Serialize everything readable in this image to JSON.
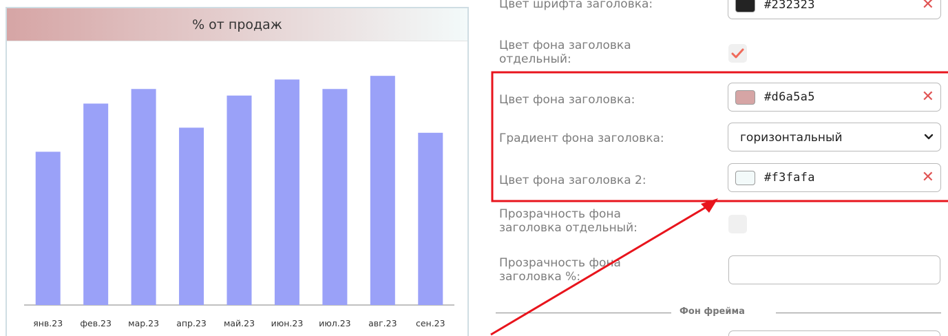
{
  "widget": {
    "title": "% от продаж",
    "header_gradient_from": "#d6a5a5",
    "header_gradient_to": "#f3fafa",
    "bar_color": "#9aa1f8"
  },
  "chart_data": {
    "type": "bar",
    "title": "% от продаж",
    "categories": [
      "янв.23",
      "фев.23",
      "мар.23",
      "апр.23",
      "май.23",
      "июн.23",
      "июл.23",
      "авг.23",
      "сен.23"
    ],
    "values": [
      210,
      276,
      296,
      243,
      287,
      309,
      296,
      314,
      236
    ],
    "xlabel": "",
    "ylabel": "",
    "ylim": [
      0,
      350
    ],
    "grid": false,
    "legend": "none"
  },
  "settings": {
    "header_font_color": {
      "label": "Цвет шрифта заголовка:",
      "value": "#232323",
      "swatch": "#232323"
    },
    "header_bg_separate": {
      "label": "Цвет фона заголовка отдельный:",
      "checked": true
    },
    "header_bg_color": {
      "label": "Цвет фона заголовка:",
      "value": "#d6a5a5",
      "swatch": "#d6a5a5"
    },
    "header_bg_gradient": {
      "label": "Градиент фона заголовка:",
      "value": "горизонтальный"
    },
    "header_bg_color2": {
      "label": "Цвет фона заголовка 2:",
      "value": "#f3fafa",
      "swatch": "#f3fafa"
    },
    "header_opacity_separate": {
      "label": "Прозрачность фона заголовка отдельный:",
      "checked": false
    },
    "header_opacity_pct": {
      "label": "Прозрачность фона заголовка %:",
      "value": ""
    },
    "frame_bg_section": "Фон фрейма",
    "clear_glyph": "✕"
  },
  "annotation": {
    "color": "#e8141c"
  }
}
